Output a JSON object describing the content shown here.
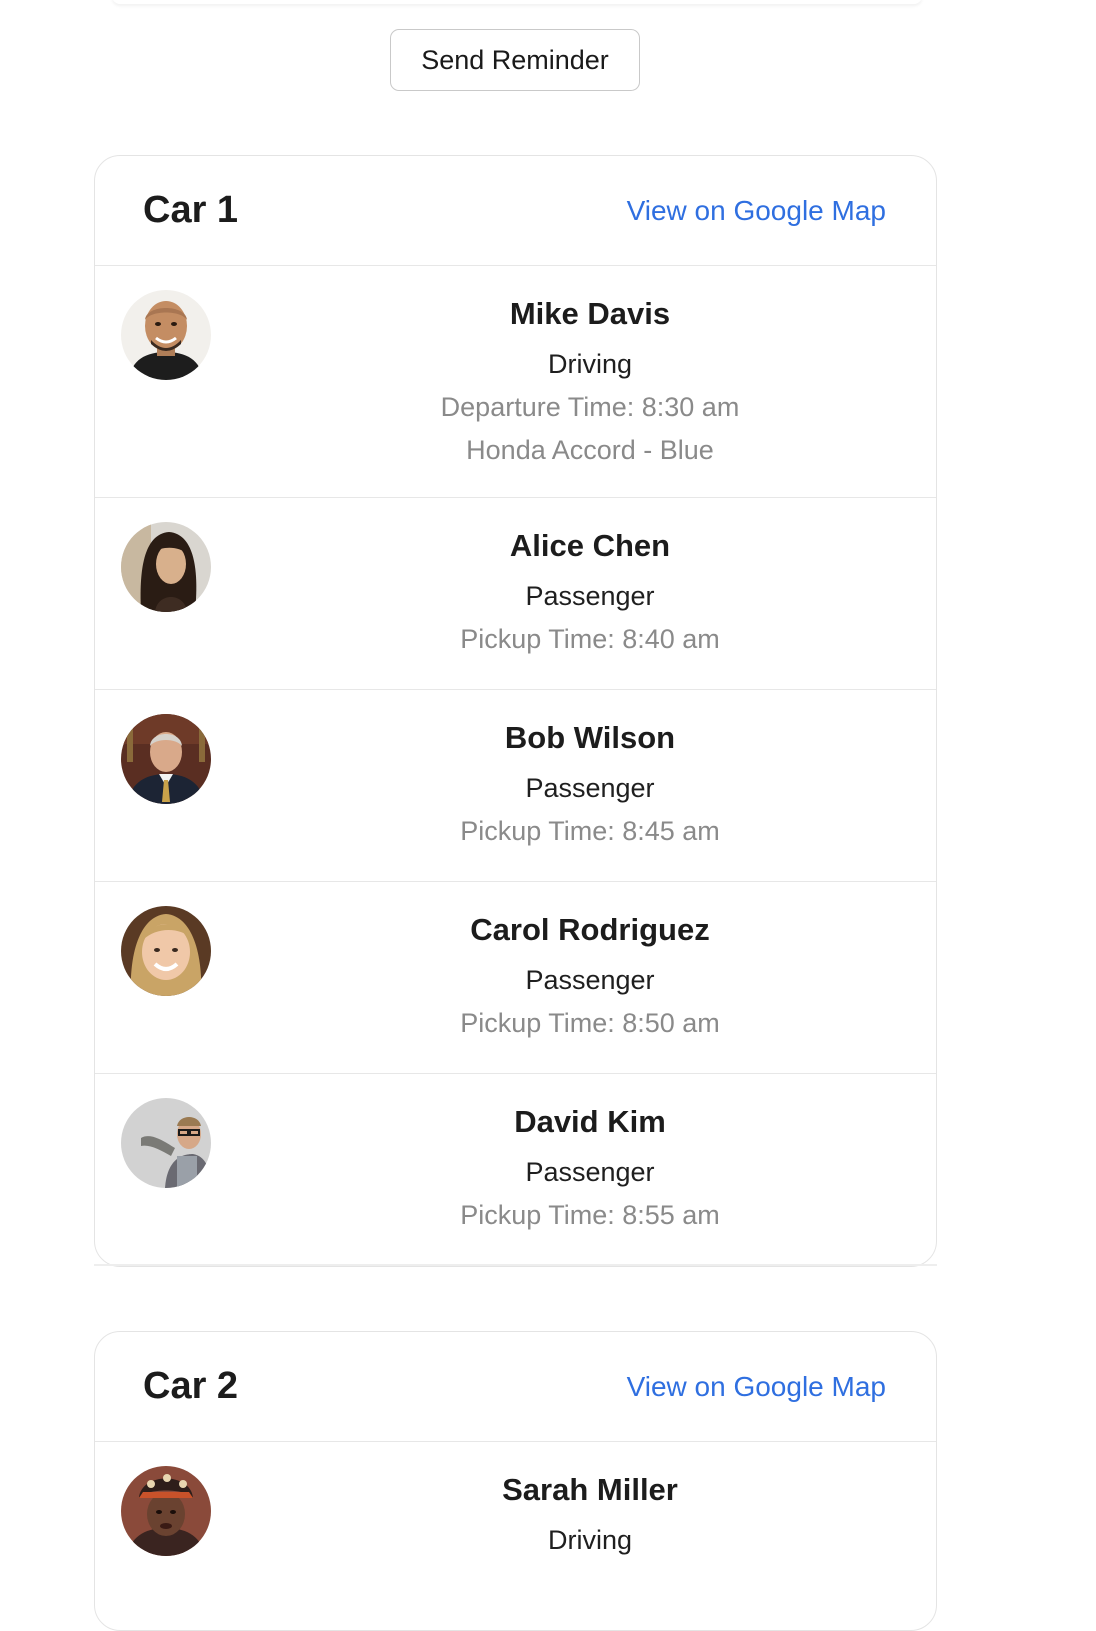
{
  "reminder_button_label": "Send Reminder",
  "link_color": "#2f6fe0",
  "cars": [
    {
      "title": "Car 1",
      "map_link_label": "View on Google Map",
      "members": [
        {
          "name": "Mike Davis",
          "role": "Driving",
          "details": [
            "Departure Time: 8:30 am",
            "Honda Accord - Blue"
          ],
          "avatar_icon": "avatar-man-bald"
        },
        {
          "name": "Alice Chen",
          "role": "Passenger",
          "details": [
            "Pickup Time: 8:40 am"
          ],
          "avatar_icon": "avatar-woman-dark-hair"
        },
        {
          "name": "Bob Wilson",
          "role": "Passenger",
          "details": [
            "Pickup Time: 8:45 am"
          ],
          "avatar_icon": "avatar-man-suit"
        },
        {
          "name": "Carol Rodriguez",
          "role": "Passenger",
          "details": [
            "Pickup Time: 8:50 am"
          ],
          "avatar_icon": "avatar-woman-blonde"
        },
        {
          "name": "David Kim",
          "role": "Passenger",
          "details": [
            "Pickup Time: 8:55 am"
          ],
          "avatar_icon": "avatar-man-glasses"
        }
      ]
    },
    {
      "title": "Car 2",
      "map_link_label": "View on Google Map",
      "members": [
        {
          "name": "Sarah Miller",
          "role": "Driving",
          "details": [],
          "avatar_icon": "avatar-woman-headwrap"
        }
      ]
    }
  ]
}
